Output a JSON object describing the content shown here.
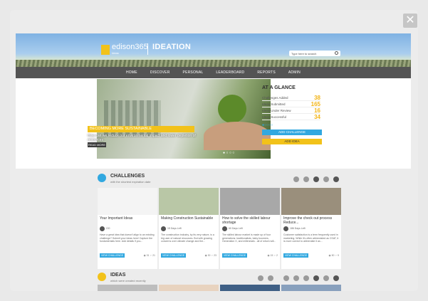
{
  "header": {
    "brand": "edison365",
    "brand_sub": "Ideas",
    "product": "IDEATION",
    "search_placeholder": "Type here to search"
  },
  "nav": [
    "HOME",
    "DISCOVER",
    "PERSONAL",
    "LEADERBOARD",
    "REPORTS",
    "ADMIN"
  ],
  "hero": {
    "title": "BECOMING MORE SUSTAINABLE",
    "description": "How can we reduce our environmental impact and lower depletion of resources",
    "button": "READ MORE",
    "dots": "● ○ ○ ○"
  },
  "glance": {
    "title": "AT A GLANCE",
    "stats": [
      {
        "label": "Challenges Added",
        "value": "38"
      },
      {
        "label": "Ideas Submitted",
        "value": "165"
      },
      {
        "label": "Ideas Under Review",
        "value": "16"
      },
      {
        "label": "Ideas Successful",
        "value": "34"
      }
    ],
    "dots": "●○○○○",
    "add_challenge": "ADD CHALLENGE",
    "add_idea": "ADD IDEA"
  },
  "challenges": {
    "title": "CHALLENGES",
    "subtitle": "with the shortest expiration date",
    "cards": [
      {
        "title": "Your Important Ideas",
        "days": "OO",
        "desc": "Have a great idea that doesn't align to an existing challenge? Submit your ideas here! Capture the fundamentals here. Add details if you...",
        "view": "VIEW CHALLENGE",
        "views": "31",
        "ideas": "21",
        "img_color": "#f4f4f4"
      },
      {
        "title": "Making Construction Sustainable",
        "days": "15 Days Left",
        "desc": "The construction industry, by its very nature, is a big user of natural resources. But with growing concerns over climate change and the...",
        "view": "VIEW CHALLENGE",
        "views": "30",
        "ideas": "23",
        "img_color": "#b9c7a6"
      },
      {
        "title": "How to solve the skilled labour shortage",
        "days": "60 Days Left",
        "desc": "The skilled labour market is made up of four generations: traditionalists, baby boomers, Generation X, and millennials - all of whom will...",
        "view": "VIEW CHALLENGE",
        "views": "15",
        "ideas": "2",
        "img_color": "#a8a8a8"
      },
      {
        "title": "Improve the check out process Reduce...",
        "days": "186 Days Left",
        "desc": "Customer satisfaction is a term frequently used in marketing. While it's often abbreviated as CSAT, it is more correct to abbreviate it as...",
        "view": "VIEW CHALLENGE",
        "views": "50",
        "ideas": "9",
        "img_color": "#9a8f7c"
      }
    ]
  },
  "ideas": {
    "title": "IDEAS",
    "subtitle": "which were created recently"
  },
  "colors": {
    "accent_blue": "#31a8e0",
    "accent_yellow": "#f2c21a",
    "nav": "#545454"
  }
}
